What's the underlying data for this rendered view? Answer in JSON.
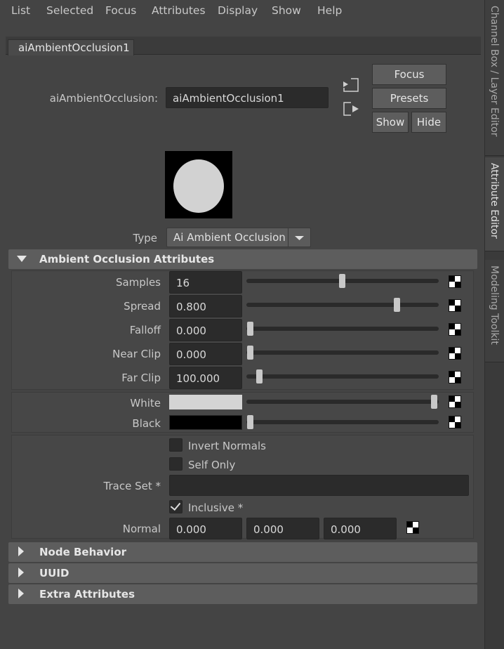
{
  "menubar": {
    "items": [
      "List",
      "Selected",
      "Focus",
      "Attributes",
      "Display",
      "Show",
      "Help"
    ]
  },
  "side_tabs": [
    "Channel Box / Layer Editor",
    "Attribute Editor",
    "Modeling Toolkit"
  ],
  "node_tab": "aiAmbientOcclusion1",
  "node": {
    "label": "aiAmbientOcclusion:",
    "value": "aiAmbientOcclusion1"
  },
  "buttons": {
    "focus": "Focus",
    "presets": "Presets",
    "show": "Show",
    "hide": "Hide"
  },
  "type": {
    "label": "Type",
    "value": "Ai Ambient Occlusion"
  },
  "sections": {
    "ao": "Ambient Occlusion Attributes",
    "node_behavior": "Node Behavior",
    "uuid": "UUID",
    "extra": "Extra Attributes"
  },
  "attributes": {
    "samples": {
      "label": "Samples",
      "value": "16",
      "slider": 0.5
    },
    "spread": {
      "label": "Spread",
      "value": "0.800",
      "slider": 0.8
    },
    "falloff": {
      "label": "Falloff",
      "value": "0.000",
      "slider": 0.0
    },
    "near_clip": {
      "label": "Near Clip",
      "value": "0.000",
      "slider": 0.0
    },
    "far_clip": {
      "label": "Far Clip",
      "value": "100.000",
      "slider": 0.05
    },
    "white": {
      "label": "White",
      "color": "#d4d4d4",
      "slider": 1.0
    },
    "black": {
      "label": "Black",
      "color": "#000000",
      "slider": 0.0
    }
  },
  "options": {
    "invert_normals": {
      "label": "Invert Normals",
      "checked": false
    },
    "self_only": {
      "label": "Self Only",
      "checked": false
    },
    "trace_set": {
      "label": "Trace Set *",
      "value": ""
    },
    "inclusive": {
      "label": "Inclusive *",
      "checked": true
    },
    "normal": {
      "label": "Normal",
      "x": "0.000",
      "y": "0.000",
      "z": "0.000"
    }
  },
  "colors": {
    "background": "#444444",
    "field": "#2b2b2b",
    "section_header": "#5d5d5d"
  }
}
